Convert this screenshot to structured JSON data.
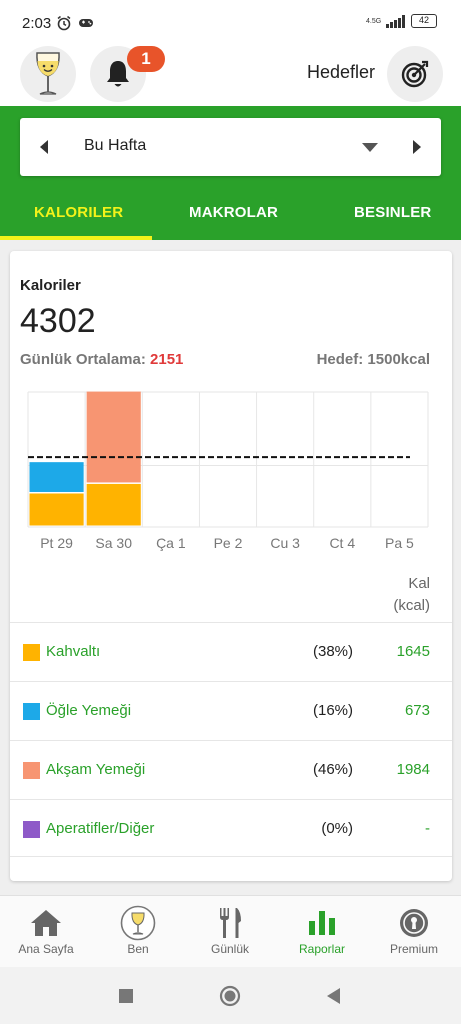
{
  "status": {
    "time": "2:03",
    "net_type": "4.5G",
    "battery": "42"
  },
  "header": {
    "goals_label": "Hedefler"
  },
  "notifications": {
    "count": "1"
  },
  "week": {
    "label": "Bu Hafta"
  },
  "tabs": [
    {
      "label": "KALORILER",
      "active": true
    },
    {
      "label": "MAKROLAR",
      "active": false
    },
    {
      "label": "BESINLER",
      "active": false
    }
  ],
  "summary": {
    "title": "Kaloriler",
    "total": "4302",
    "daily_avg_label": "Günlük Ortalama:",
    "daily_avg_value": "2151",
    "goal_text": "Hedef: 1500kcal"
  },
  "chart_data": {
    "type": "bar",
    "stacked": true,
    "categories": [
      "Pt 29",
      "Sa 30",
      "Ça 1",
      "Pe 2",
      "Cu 3",
      "Ct 4",
      "Pa 5"
    ],
    "series": [
      {
        "name": "Kahvaltı",
        "color": "#FFB300",
        "values": [
          720,
          925,
          0,
          0,
          0,
          0,
          0
        ]
      },
      {
        "name": "Öğle Yemeği",
        "color": "#1DA9E8",
        "values": [
          673,
          0,
          0,
          0,
          0,
          0,
          0
        ]
      },
      {
        "name": "Akşam Yemeği",
        "color": "#F79572",
        "values": [
          0,
          1984,
          0,
          0,
          0,
          0,
          0
        ]
      },
      {
        "name": "Aperatifler/Diğer",
        "color": "#8E5AC8",
        "values": [
          0,
          0,
          0,
          0,
          0,
          0,
          0
        ]
      }
    ],
    "goal_line": 1500,
    "ylim": [
      0,
      2900
    ],
    "grid": true,
    "legend": "none"
  },
  "table": {
    "header_line1": "Kal",
    "header_line2": "(kcal)",
    "rows": [
      {
        "name": "Kahvaltı",
        "pct": "(38%)",
        "kcal": "1645",
        "color": "#FFB300"
      },
      {
        "name": "Öğle Yemeği",
        "pct": "(16%)",
        "kcal": "673",
        "color": "#1DA9E8"
      },
      {
        "name": "Akşam Yemeği",
        "pct": "(46%)",
        "kcal": "1984",
        "color": "#F79572"
      },
      {
        "name": "Aperatifler/Diğer",
        "pct": "(0%)",
        "kcal": "-",
        "color": "#8E5AC8"
      }
    ]
  },
  "bottom_nav": [
    {
      "label": "Ana Sayfa",
      "icon": "home-icon"
    },
    {
      "label": "Ben",
      "icon": "profile-icon"
    },
    {
      "label": "Günlük",
      "icon": "fork-knife-icon"
    },
    {
      "label": "Raporlar",
      "icon": "bar-chart-icon",
      "active": true
    },
    {
      "label": "Premium",
      "icon": "premium-icon"
    }
  ],
  "colors": {
    "brand_green": "#2AA12A",
    "tab_active": "#F3F21A",
    "badge": "#E8542A",
    "avg_red": "#E03A3A"
  }
}
